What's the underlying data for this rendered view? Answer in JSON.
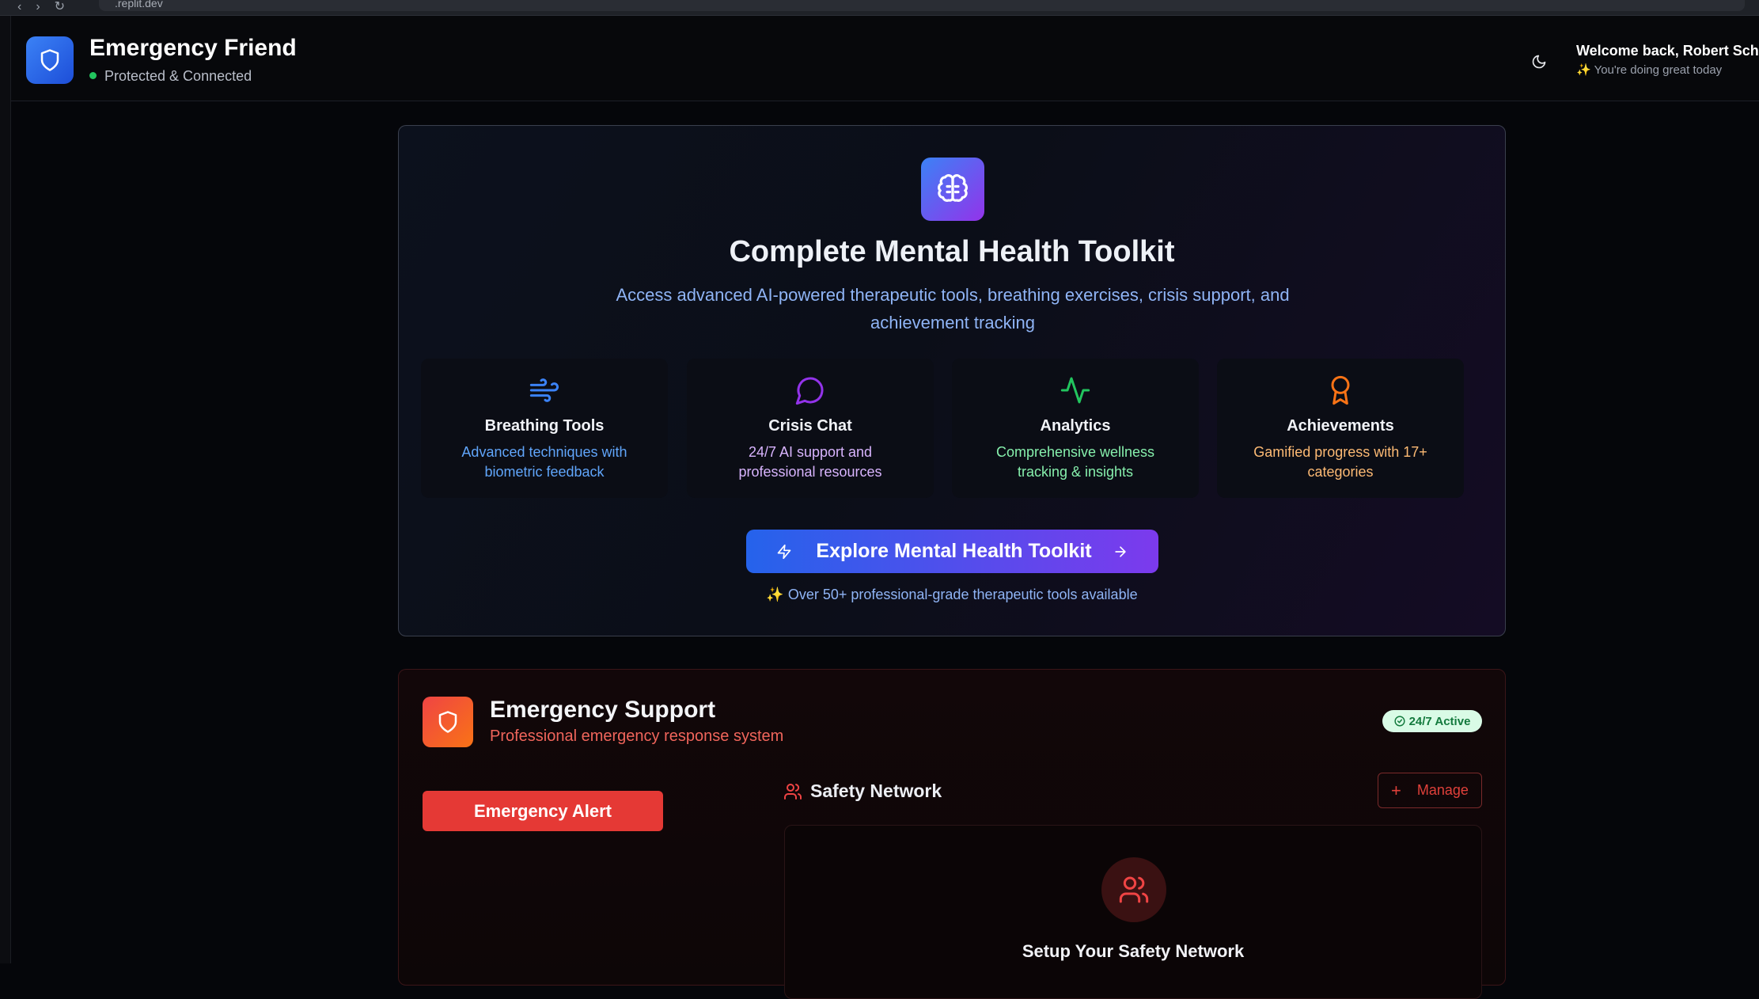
{
  "browser": {
    "url": ".replit.dev"
  },
  "header": {
    "app_title": "Emergency Friend",
    "status_text": "Protected & Connected",
    "welcome": "Welcome back, Robert Schuelk",
    "welcome_sub": "✨ You're doing great today"
  },
  "toolkit": {
    "title": "Complete Mental Health Toolkit",
    "description": "Access advanced AI-powered therapeutic tools, breathing exercises, crisis support, and achievement tracking",
    "features": [
      {
        "icon": "wind-icon",
        "title": "Breathing Tools",
        "desc": "Advanced techniques with biometric feedback",
        "color": "#60a5fa",
        "icon_color": "#3b82f6"
      },
      {
        "icon": "message-circle-icon",
        "title": "Crisis Chat",
        "desc": "24/7 AI support and professional resources",
        "color": "#d8b4fe",
        "icon_color": "#9333ea"
      },
      {
        "icon": "activity-icon",
        "title": "Analytics",
        "desc": "Comprehensive wellness tracking & insights",
        "color": "#86efac",
        "icon_color": "#22c55e"
      },
      {
        "icon": "award-icon",
        "title": "Achievements",
        "desc": "Gamified progress with 17+ categories",
        "color": "#fdba74",
        "icon_color": "#f97316"
      }
    ],
    "cta_label": "Explore Mental Health Toolkit",
    "note": "✨ Over 50+ professional-grade therapeutic tools available"
  },
  "emergency": {
    "title": "Emergency Support",
    "subtitle": "Professional emergency response system",
    "badge": "24/7 Active",
    "alert_label": "Emergency Alert",
    "safety_title": "Safety Network",
    "manage_label": "Manage",
    "setup_title": "Setup Your Safety Network"
  }
}
